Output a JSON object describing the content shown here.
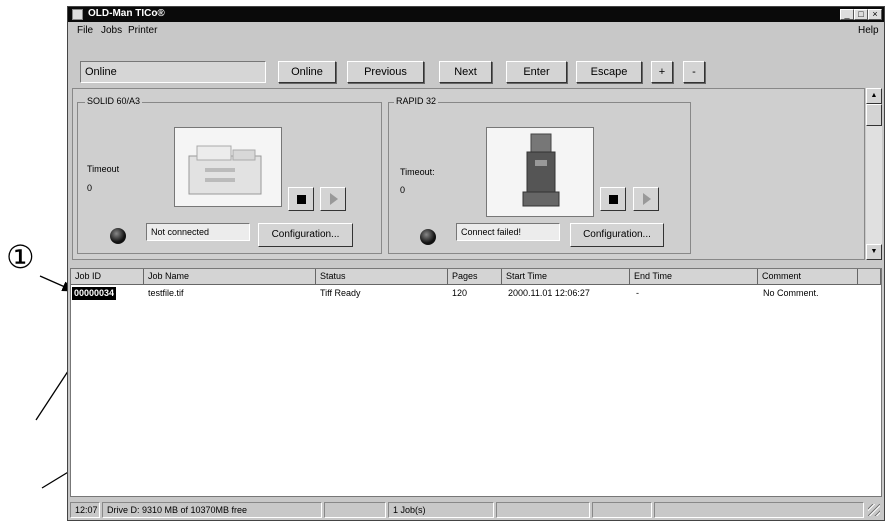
{
  "window": {
    "title": "OLD-Man TICo®"
  },
  "menu": {
    "file": "File",
    "jobs": "Jobs",
    "printer": "Printer",
    "help": "Help"
  },
  "toolbar": {
    "status_value": "Online",
    "buttons": [
      "Online",
      "Previous",
      "Next",
      "Enter",
      "Escape",
      "+",
      "-"
    ]
  },
  "printers": [
    {
      "name": "SOLID 60/A3",
      "timeout_label": "Timeout",
      "timeout_value": "0",
      "status": "Not connected",
      "config_label": "Configuration..."
    },
    {
      "name": "RAPID 32",
      "timeout_label": "Timeout:",
      "timeout_value": "0",
      "status": "Connect failed!",
      "config_label": "Configuration..."
    }
  ],
  "table": {
    "headers": [
      "Job ID",
      "Job Name",
      "Status",
      "Pages",
      "Start Time",
      "End Time",
      "Comment"
    ],
    "rows": [
      [
        "00000034",
        "testfile.tif",
        "Tiff Ready",
        "120",
        "2000.11.01 12:06:27",
        "-",
        "No Comment."
      ]
    ]
  },
  "statusbar": {
    "time": "12:07",
    "drive": "Drive D: 9310 MB of 10370MB free",
    "jobs": "1 Job(s)"
  },
  "annotation": {
    "marker": "①"
  },
  "colors": {
    "titlebar": "#0a0a0a",
    "window": "#c8c8c8",
    "selection": "#000000"
  }
}
